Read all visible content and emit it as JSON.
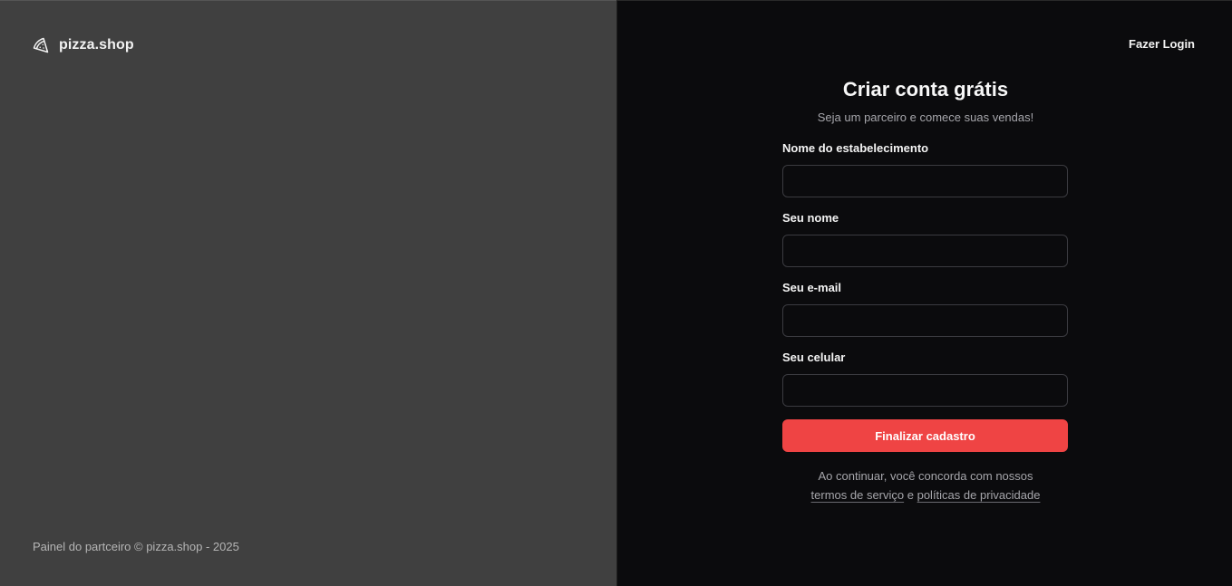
{
  "brand": {
    "name": "pizza.shop",
    "icon": "pizza-icon"
  },
  "footer": {
    "text": "Painel do partceiro © pizza.shop - 2025"
  },
  "header": {
    "login_link": "Fazer Login"
  },
  "form": {
    "title": "Criar conta grátis",
    "subtitle": "Seja um parceiro e comece suas vendas!",
    "fields": [
      {
        "label": "Nome do estabelecimento",
        "value": "",
        "placeholder": ""
      },
      {
        "label": "Seu nome",
        "value": "",
        "placeholder": ""
      },
      {
        "label": "Seu e-mail",
        "value": "",
        "placeholder": ""
      },
      {
        "label": "Seu celular",
        "value": "",
        "placeholder": ""
      }
    ],
    "submit_label": "Finalizar cadastro",
    "terms": {
      "prefix": "Ao continuar, você concorda com nossos ",
      "terms_link": "termos de serviço",
      "connector": " e ",
      "privacy_link": "políticas de privacidade"
    }
  },
  "colors": {
    "left_panel": "#404040",
    "right_panel": "#0b0b0d",
    "accent": "#ef4444"
  }
}
